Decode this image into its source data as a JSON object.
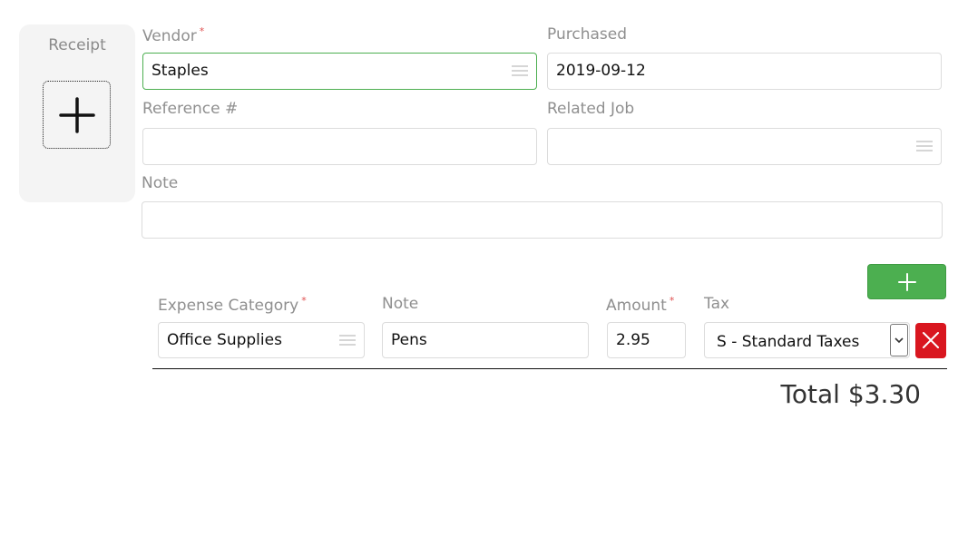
{
  "receipt": {
    "title": "Receipt"
  },
  "header": {
    "vendor": {
      "label": "Vendor",
      "required_mark": "*",
      "value": "Staples"
    },
    "purchased": {
      "label": "Purchased",
      "value": "2019-09-12"
    },
    "reference": {
      "label": "Reference #",
      "value": ""
    },
    "related_job": {
      "label": "Related Job",
      "value": ""
    },
    "note": {
      "label": "Note",
      "value": ""
    }
  },
  "lines": {
    "columns": {
      "category": "Expense Category",
      "category_required": "*",
      "note": "Note",
      "amount": "Amount",
      "amount_required": "*",
      "tax": "Tax"
    },
    "rows": [
      {
        "category": "Office Supplies",
        "note": "Pens",
        "amount": "2.95",
        "tax": "S - Standard Taxes"
      }
    ]
  },
  "total": {
    "text": "Total $3.30"
  },
  "icons": {
    "add": "plus-icon",
    "menu": "menu-lines-icon",
    "remove": "close-icon",
    "select": "chevron-down-icon"
  },
  "colors": {
    "accent_green": "#4caf50",
    "danger_red": "#d9161f",
    "required_red": "#e05050",
    "label_gray": "#8f8f8f",
    "panel_bg": "#f4f4f4"
  }
}
